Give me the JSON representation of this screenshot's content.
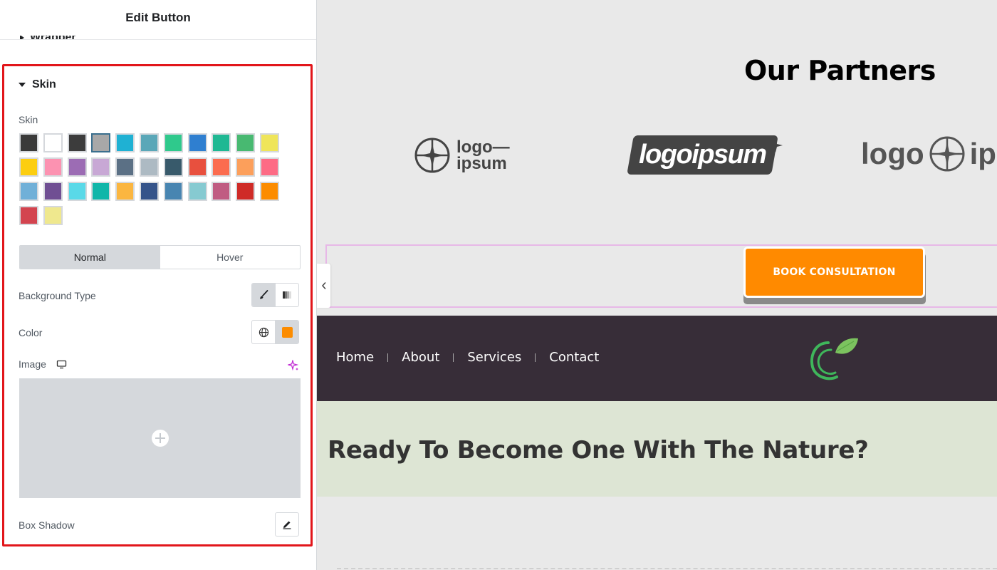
{
  "panel": {
    "title": "Edit Button",
    "wrapper_label": "Wrapper",
    "skin_section_title": "Skin",
    "skin_label": "Skin",
    "swatches": [
      "#3a3a3a",
      "#ffffff",
      "#3c3c3c",
      "#a8a8a8",
      "#1fb1d3",
      "#5aa7b8",
      "#2fc98c",
      "#2f7fd0",
      "#1fb893",
      "#48b971",
      "#efe55a",
      "#fcce10",
      "#fc92b1",
      "#9c6cb4",
      "#c8a8d5",
      "#5b7085",
      "#adbac3",
      "#385a6b",
      "#e8503e",
      "#fb6c4f",
      "#fc9f5b",
      "#fd6b85",
      "#70b0d8",
      "#704f93",
      "#5ad9e8",
      "#11b6a9",
      "#fbb640",
      "#35548a",
      "#4885b1",
      "#86cad1",
      "#c05c82",
      "#cf2b27",
      "#fc8c00",
      "#d3444f",
      "#efe88e"
    ],
    "selected_swatch_index": 3,
    "state_tabs": [
      "Normal",
      "Hover"
    ],
    "active_state_tab": "Normal",
    "background_type_label": "Background Type",
    "color_label": "Color",
    "color_value": "#fc8c00",
    "image_label": "Image",
    "box_shadow_label": "Box Shadow"
  },
  "preview": {
    "partners_title": "Our Partners",
    "logos": [
      {
        "line1": "logo—",
        "line2": "ipsum"
      },
      {
        "text": "logoipsum"
      },
      {
        "text_left": "logo",
        "text_right": "ips"
      }
    ],
    "book_button_label": "BOOK CONSULTATION",
    "nav_items": [
      "Home",
      "About",
      "Services",
      "Contact"
    ],
    "cta_title": "Ready To Become One With The Nature?"
  },
  "colors": {
    "accent_orange": "#ff8a00",
    "nav_bg": "#372d38",
    "cta_bg": "#dde5d4",
    "highlight_red": "#e2161b"
  }
}
